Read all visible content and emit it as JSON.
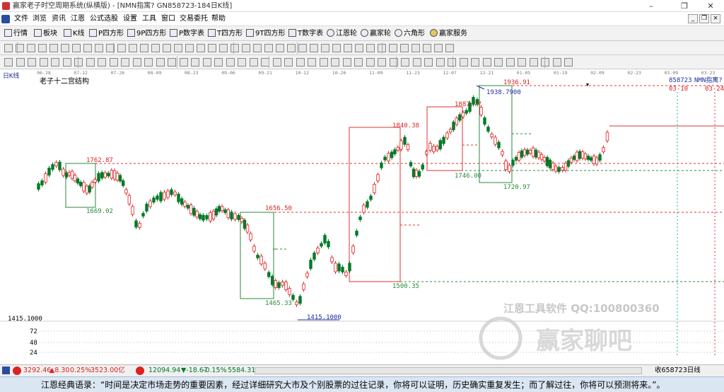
{
  "window": {
    "title": "赢家老子时空周期系统(纵横版) - [NMN指寓? GN858723-184日K线]",
    "minimize": "–",
    "restore": "❐",
    "close": "✕"
  },
  "menu": {
    "items": [
      "文件",
      "浏览",
      "资讯",
      "江恩",
      "公式选股",
      "设置",
      "工具",
      "窗口",
      "交易委托",
      "帮助"
    ],
    "mdi_min": "_",
    "mdi_restore": "❐",
    "mdi_close": "×"
  },
  "toolbar": {
    "items": [
      "行情",
      "板块",
      "K线",
      "P四方形",
      "9P四方形",
      "P数字表",
      "T四方形",
      "9T四方形",
      "T数字表",
      "江恩轮",
      "赢家轮",
      "六角形",
      "赢家服务"
    ]
  },
  "chart": {
    "period_label": "日K线",
    "structure_label": "老子十二宫结构",
    "code_label": "858723",
    "name_label": "NMN指寓?",
    "marker_left": "03-10",
    "marker_right": "03-24",
    "watermark_text": "江恩工具软件 QQ:100800360",
    "watermark_logo": "赢家聊吧",
    "date_ticks": [
      "06-28",
      "07-12",
      "07-26",
      "08-09",
      "08-23",
      "09-06",
      "09-21",
      "10-12",
      "10-26",
      "11-09",
      "11-23",
      "12-07",
      "12-21",
      "01-05",
      "01-19",
      "02-09",
      "02-23",
      "03-09",
      "03-23"
    ],
    "price_labels": {
      "l1762": "1762.87",
      "l1669": "1669.02",
      "l1656": "1656.50",
      "l1465": "1465.33",
      "l1415": "1415.1000",
      "l1840": "1840.38",
      "l1500": "1500.35",
      "l1887": "1887.77",
      "l1746": "1746.00",
      "l1936": "1936.91",
      "l1938": "1938.7900",
      "l1720": "1720.97"
    },
    "y_axis": {
      "base": "1415.1000",
      "vol_ticks": [
        "72",
        "48",
        "24"
      ]
    }
  },
  "status": {
    "sh_value": "3292.46",
    "sh_change": "▲8.30",
    "sh_pct": "0.25%",
    "sh_amount": "3523.00亿",
    "sz_value": "12094.94",
    "sz_change": "▼-18.67",
    "sz_pct": "-0.15%",
    "sz_amount": "5584.31",
    "right_text": "收658723日线"
  },
  "quote_text": "江恩经典语录：“时间是决定市场走势的重要因素，经过详细研究大市及个别股票的过往记录，你将可以证明，历史确实重复发生；而了解过往，你将可以预测将来。”。",
  "colors": {
    "up": "#e41e1e",
    "down": "#007a28",
    "accent_blue": "#1d2fa3"
  }
}
